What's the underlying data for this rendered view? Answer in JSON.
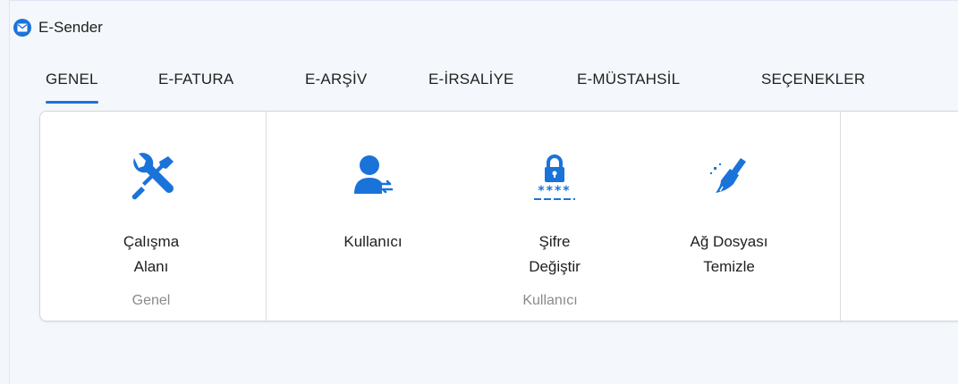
{
  "app": {
    "title": "E-Sender",
    "accent": "#1a73d9"
  },
  "tabs": [
    {
      "label": "GENEL",
      "active": true
    },
    {
      "label": "E-FATURA"
    },
    {
      "label": "E-ARŞİV"
    },
    {
      "label": "E-İRSALİYE"
    },
    {
      "label": "E-MÜSTAHSİL"
    },
    {
      "label": "SEÇENEKLER"
    }
  ],
  "ribbon": {
    "groups": [
      {
        "label": "Genel",
        "commands": [
          {
            "line1": "Çalışma",
            "line2": "Alanı",
            "icon": "tools-icon"
          }
        ]
      },
      {
        "label": "Kullanıcı",
        "commands": [
          {
            "line1": "Kullanıcı",
            "line2": "",
            "icon": "user-switch-icon"
          },
          {
            "line1": "Şifre",
            "line2": "Değiştir",
            "icon": "lock-password-icon"
          },
          {
            "line1": "Ağ Dosyası",
            "line2": "Temizle",
            "icon": "broom-icon"
          }
        ]
      }
    ]
  }
}
